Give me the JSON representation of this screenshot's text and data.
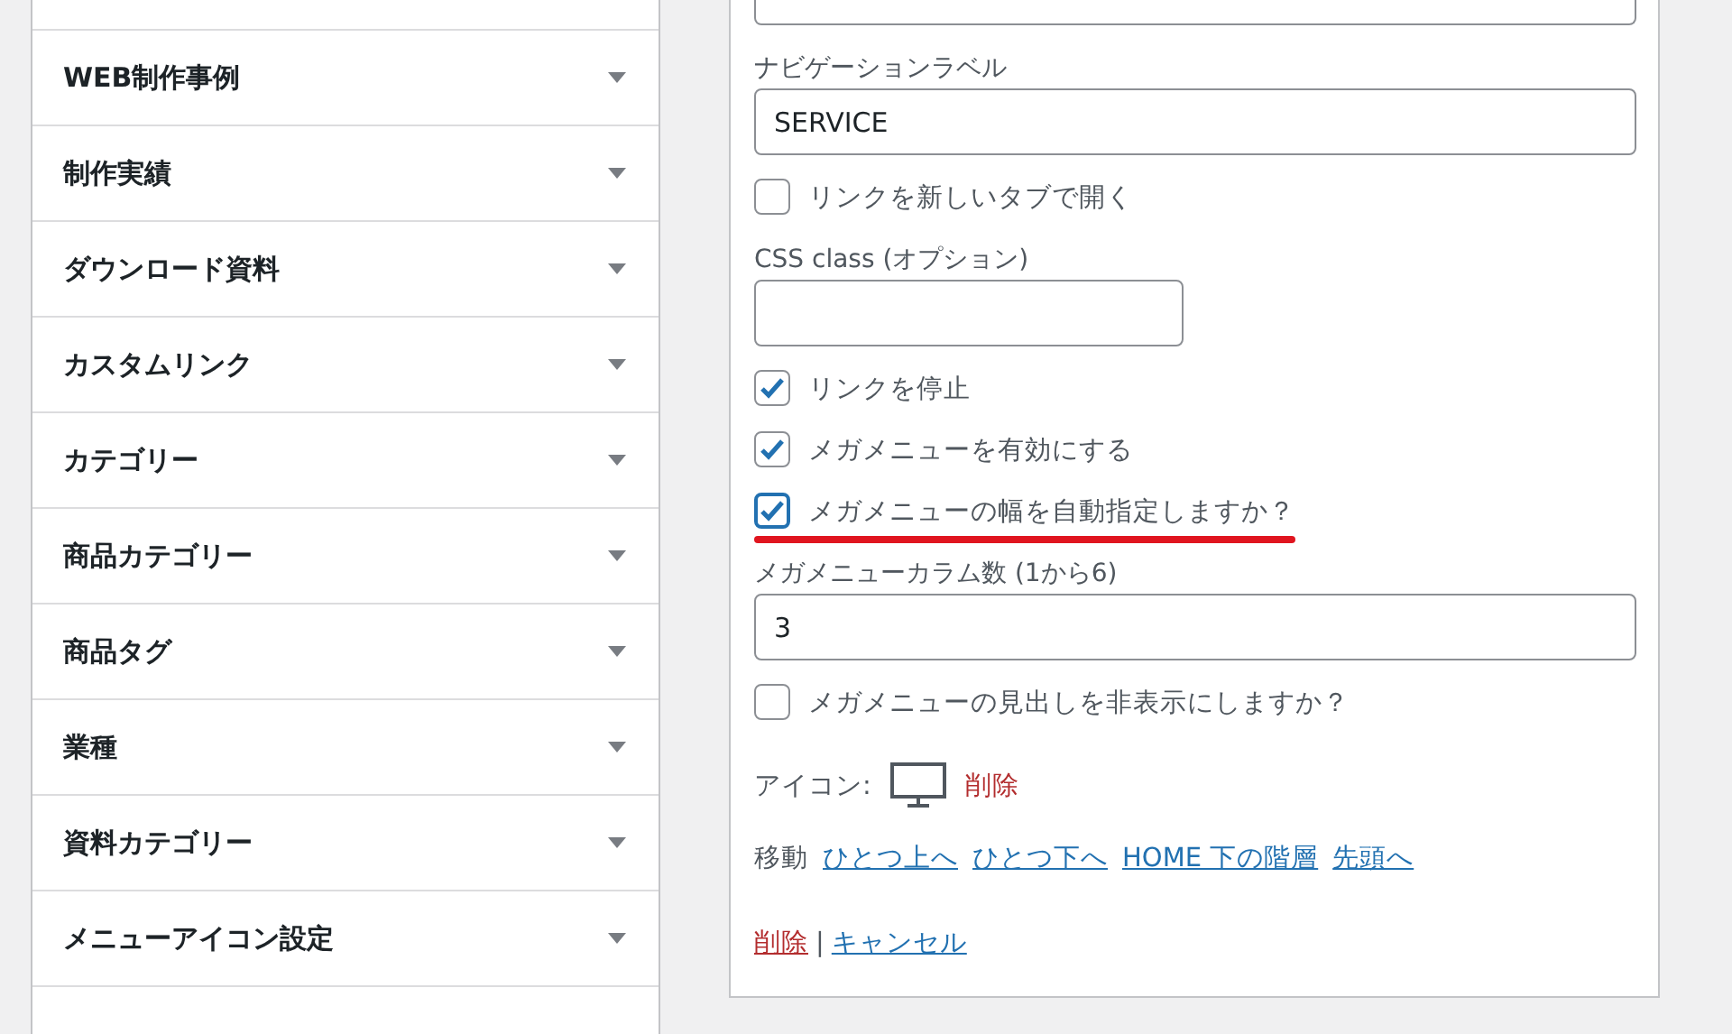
{
  "menu_sections": [
    {
      "label": "WEB制作事例",
      "expanded": false
    },
    {
      "label": "制作実績",
      "expanded": false
    },
    {
      "label": "ダウンロード資料",
      "expanded": false
    },
    {
      "label": "カスタムリンク",
      "expanded": false
    },
    {
      "label": "カテゴリー",
      "expanded": false
    },
    {
      "label": "商品カテゴリー",
      "expanded": false
    },
    {
      "label": "商品タグ",
      "expanded": false
    },
    {
      "label": "業種",
      "expanded": false
    },
    {
      "label": "資料カテゴリー",
      "expanded": false
    },
    {
      "label": "メニューアイコン設定",
      "expanded": false
    }
  ],
  "menu_item_settings": {
    "fields": [
      {
        "kind": "text",
        "label": "ナビゲーションラベル",
        "value": "SERVICE"
      },
      {
        "kind": "checkbox",
        "label": "リンクを新しいタブで開く",
        "checked": false,
        "highlighted": false
      },
      {
        "kind": "short-text",
        "label": "CSS class (オプション)"
      },
      {
        "kind": "checkbox",
        "label": "リンクを停止",
        "checked": true,
        "highlighted": false
      },
      {
        "kind": "checkbox",
        "label": "メガメニューを有効にする",
        "checked": true,
        "highlighted": false
      },
      {
        "kind": "checkbox",
        "label": "メガメニューの幅を自動指定しますか？",
        "checked": true,
        "highlighted": true
      },
      {
        "kind": "text",
        "label": "メガメニューカラム数 (1から6)",
        "value": "3"
      },
      {
        "kind": "checkbox",
        "label": "メガメニューの見出しを非表示にしますか？",
        "checked": false,
        "highlighted": false
      }
    ],
    "icon": {
      "label": "アイコン:",
      "remove_link": "削除"
    },
    "move": {
      "label": "移動",
      "links": [
        "ひとつ上へ",
        "ひとつ下へ",
        "HOME 下の階層",
        "先頭へ"
      ]
    },
    "actions": {
      "delete": "削除",
      "separator": "|",
      "cancel": "キャンセル"
    }
  }
}
